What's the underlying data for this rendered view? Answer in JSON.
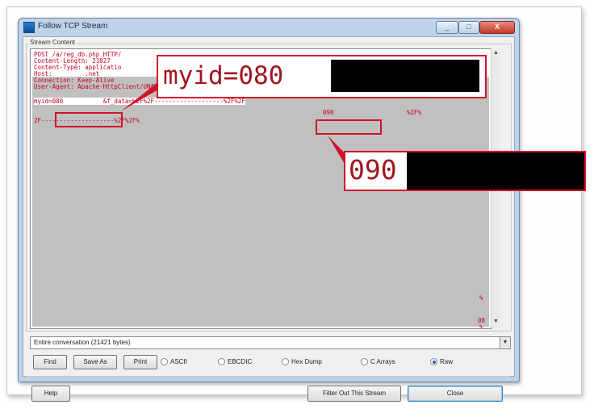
{
  "window": {
    "title": "Follow TCP Stream",
    "controls": [
      "_",
      "□",
      "X"
    ]
  },
  "stream": {
    "group_label": "Stream Content",
    "lines": [
      "POST /a/reg_db.php HTTP/",
      "Content-Length: 21027",
      "Content-Type: applicatio",
      "Host:         .net",
      "Connection: Keep-Alive",
      "User-Agent: Apache-HttpClient/UNAVAILABLE (java 1.4)"
    ],
    "myid_line": "myid=080           &f_data=%2F%2F-------------------%2F%2F",
    "value_090": "090",
    "value_2f": "%2F%",
    "line2": "2F--------------------%2F%2F%",
    "right_marks": [
      "%",
      "08",
      "%"
    ],
    "zoom1": "myid=080",
    "zoom2": "090"
  },
  "conversation": "Entire conversation (21421 bytes)",
  "buttons": {
    "find": "Find",
    "save_as": "Save As",
    "print": "Print",
    "help": "Help",
    "filter": "Filter Out This Stream",
    "close": "Close"
  },
  "radios": [
    {
      "label": "ASCII",
      "selected": false
    },
    {
      "label": "EBCDIC",
      "selected": false
    },
    {
      "label": "Hex Dump",
      "selected": false
    },
    {
      "label": "C Arrays",
      "selected": false
    },
    {
      "label": "Raw",
      "selected": true
    }
  ],
  "colors": {
    "stream_text": "#c4001f",
    "highlight": "#d1122b"
  }
}
